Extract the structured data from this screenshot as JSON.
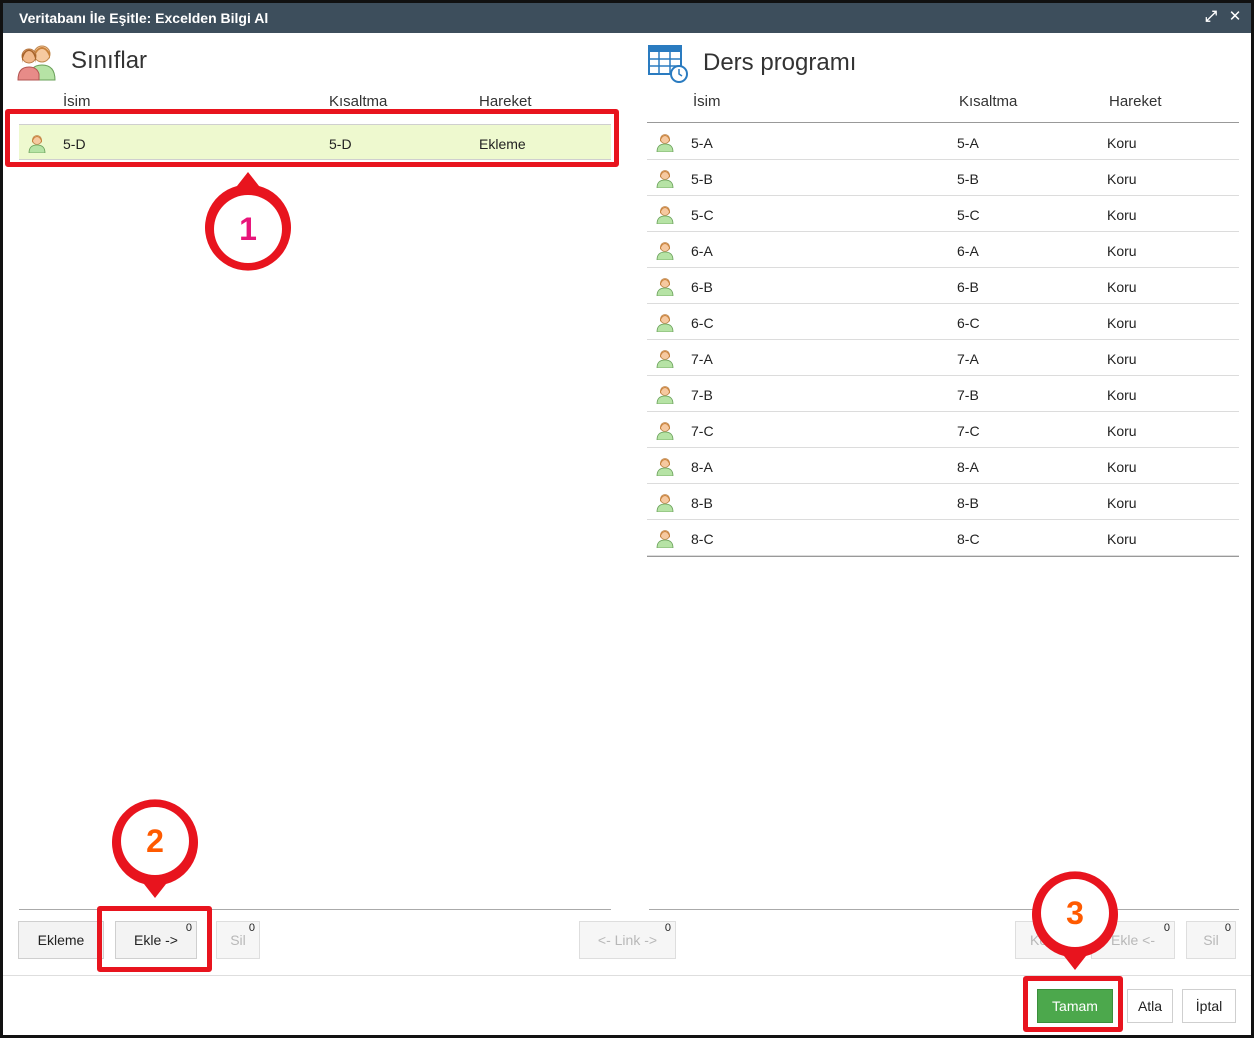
{
  "window": {
    "title": "Veritabanı İle Eşitle: Excelden Bilgi Al",
    "maximize_glyph": "⤢",
    "close_glyph": "✕"
  },
  "left_panel": {
    "title": "Sınıflar",
    "icon": "people-icon",
    "columns": {
      "name": "İsim",
      "short": "Kısaltma",
      "action": "Hareket"
    },
    "rows": [
      {
        "name": "5-D",
        "short": "5-D",
        "action": "Ekleme"
      }
    ]
  },
  "right_panel": {
    "title": "Ders programı",
    "icon": "timetable-clock-icon",
    "columns": {
      "name": "İsim",
      "short": "Kısaltma",
      "action": "Hareket"
    },
    "rows": [
      {
        "name": "5-A",
        "short": "5-A",
        "action": "Koru"
      },
      {
        "name": "5-B",
        "short": "5-B",
        "action": "Koru"
      },
      {
        "name": "5-C",
        "short": "5-C",
        "action": "Koru"
      },
      {
        "name": "6-A",
        "short": "6-A",
        "action": "Koru"
      },
      {
        "name": "6-B",
        "short": "6-B",
        "action": "Koru"
      },
      {
        "name": "6-C",
        "short": "6-C",
        "action": "Koru"
      },
      {
        "name": "7-A",
        "short": "7-A",
        "action": "Koru"
      },
      {
        "name": "7-B",
        "short": "7-B",
        "action": "Koru"
      },
      {
        "name": "7-C",
        "short": "7-C",
        "action": "Koru"
      },
      {
        "name": "8-A",
        "short": "8-A",
        "action": "Koru"
      },
      {
        "name": "8-B",
        "short": "8-B",
        "action": "Koru"
      },
      {
        "name": "8-C",
        "short": "8-C",
        "action": "Koru"
      }
    ]
  },
  "left_buttons": {
    "ekleme": "Ekleme",
    "ekle": "Ekle ->",
    "ekle_count": "0",
    "sil": "Sil",
    "sil_count": "0"
  },
  "middle_buttons": {
    "link": "<- Link ->",
    "link_count": "0"
  },
  "right_buttons": {
    "koru": "Koru",
    "ekle": "Ekle <-",
    "ekle_count": "0",
    "sil": "Sil",
    "sil_count": "0"
  },
  "dialog_buttons": {
    "ok": "Tamam",
    "skip": "Atla",
    "cancel": "İptal"
  },
  "markers": [
    {
      "label": "1",
      "color": "#e8147a"
    },
    {
      "label": "2",
      "color": "#ff5a00"
    },
    {
      "label": "3",
      "color": "#ff5a00"
    }
  ],
  "colors": {
    "titlebar": "#3d4e5c",
    "highlight": "#e8141e",
    "selected_row": "#eef9cf",
    "ok_button": "#4ca84c"
  }
}
